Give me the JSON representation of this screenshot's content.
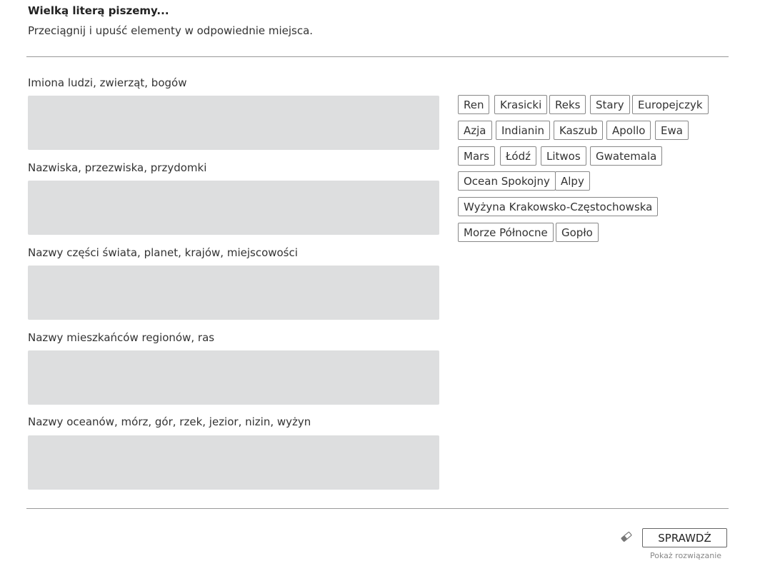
{
  "header": {
    "title": "Wielką literą piszemy...",
    "instruction": "Przeciągnij i upuść elementy w odpowiednie miejsca."
  },
  "categories": [
    {
      "label": "Imiona ludzi, zwierząt, bogów"
    },
    {
      "label": "Nazwiska, przezwiska, przydomki"
    },
    {
      "label": "Nazwy części świata, planet, krajów, miejscowości"
    },
    {
      "label": "Nazwy mieszkańców regionów, ras"
    },
    {
      "label": "Nazwy oceanów, mórz, gór, rzek, jezior, nizin, wyżyn"
    }
  ],
  "tiles": [
    "Ren",
    "Krasicki",
    "Reks",
    "Stary",
    "Europejczyk",
    "Azja",
    "Indianin",
    "Kaszub",
    "Apollo",
    "Ewa",
    "Mars",
    "Łódź",
    "Litwos",
    "Gwatemala",
    "Ocean Spokojny",
    "Alpy",
    "Wyżyna Krakowsko-Częstochowska",
    "Morze Północne",
    "Gopło"
  ],
  "footer": {
    "eraser_icon": "eraser-icon",
    "check_label": "SPRAWDŹ",
    "solution_label": "Pokaż rozwiązanie"
  }
}
